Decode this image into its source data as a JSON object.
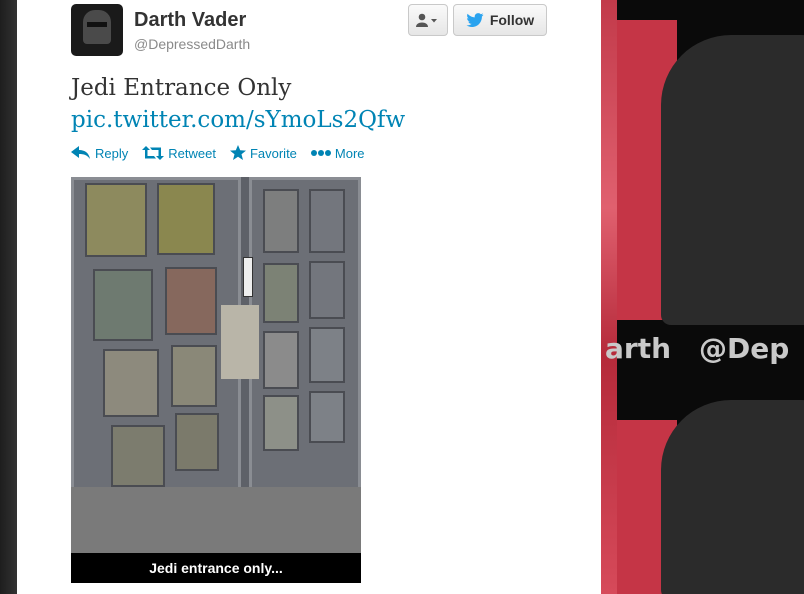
{
  "tweet": {
    "author_name": "Darth Vader",
    "author_handle": "@DepressedDarth",
    "text": "Jedi Entrance Only",
    "link": "pic.twitter.com/sYmoLs2Qfw",
    "photo_caption": "Jedi entrance only..."
  },
  "buttons": {
    "user_menu_icon": "person-dropdown-icon",
    "follow_label": "Follow",
    "follow_icon": "twitter-bird-icon"
  },
  "actions": [
    {
      "label": "Reply",
      "icon": "reply-arrow-icon"
    },
    {
      "label": "Retweet",
      "icon": "retweet-icon"
    },
    {
      "label": "Favorite",
      "icon": "star-icon"
    },
    {
      "label": "More",
      "icon": "more-dots-icon"
    }
  ],
  "background": {
    "right_text_1": "arth",
    "right_text_2": "@Dep"
  },
  "colors": {
    "link": "#0084b4",
    "text": "#333333",
    "muted": "#8a8a8a",
    "bg_accent": "#c53546"
  }
}
